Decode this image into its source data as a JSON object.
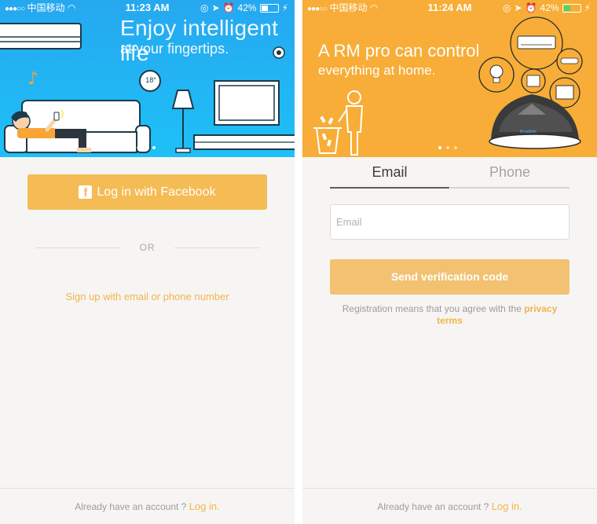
{
  "left": {
    "status": {
      "carrier": "中国移动",
      "time": "11:23 AM",
      "battery": "42%"
    },
    "hero": {
      "tagline_line1": "Enjoy intelligent life",
      "tagline_line2": "at your fingertips.",
      "thermostat": "18°"
    },
    "facebook_button": "Log in with Facebook",
    "or": "OR",
    "signup_link": "Sign up with email or phone number",
    "footer": {
      "text": "Already have an account ?",
      "login": "Log in."
    }
  },
  "right": {
    "status": {
      "carrier": "中国移动",
      "time": "11:24 AM",
      "battery": "42%"
    },
    "hero": {
      "tagline_line1": "A RM pro can control",
      "tagline_line2": "everything at home.",
      "device_brand": "Broadlink"
    },
    "tabs": [
      {
        "label": "Email",
        "active": true
      },
      {
        "label": "Phone",
        "active": false
      }
    ],
    "email_field": {
      "value": "",
      "placeholder": "Email"
    },
    "send_button": "Send verification code",
    "terms": {
      "text": "Registration means that you agree with the",
      "link": "privacy terms"
    },
    "footer": {
      "text": "Already have an account ?",
      "login": "Log in."
    }
  },
  "colors": {
    "accent": "#f5bb55",
    "hero_blue": "#1eb4f3",
    "hero_orange": "#f7ad37",
    "background": "#f6f5f3"
  }
}
